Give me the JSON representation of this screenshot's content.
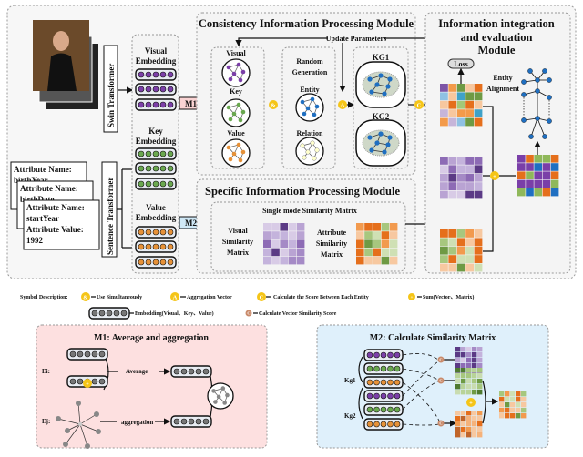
{
  "modules": {
    "consistency_title": "Consistency Information Processing Module",
    "specific_title": "Specific Information Processing Module",
    "integration_title": [
      "Information integration",
      "and evaluation",
      "Module"
    ],
    "update_parameters": "Update Parameters",
    "loss": "Loss",
    "entity_alignment": [
      "Entity",
      "Alignment"
    ]
  },
  "encoders": {
    "swin": "Swin Transformer",
    "sentence": "Sentence Transformer"
  },
  "embeddings": {
    "visual": [
      "Visual",
      "Embedding"
    ],
    "key": [
      "Key",
      "Embedding"
    ],
    "value": [
      "Value",
      "Embedding"
    ]
  },
  "attribute_cards": [
    {
      "lines": [
        "Attribute Name:",
        "birthYear"
      ]
    },
    {
      "lines": [
        "Attribute Name:",
        "birthDate"
      ]
    },
    {
      "lines": [
        "Attribute Name:",
        "startYear",
        "Attribute Value:",
        "1992"
      ]
    }
  ],
  "m1_tag": "M1",
  "m2_tag": "M2",
  "consistency": {
    "visual": "Visual",
    "key": "Key",
    "value": "Value",
    "random_generation": [
      "Random",
      "Generation"
    ],
    "entity": "Entity",
    "relation": "Relation",
    "kg1": "KG1",
    "kg2": "KG2"
  },
  "specific": {
    "single_mode": "Single mode Similarity Matrix",
    "visual_matrix": [
      "Visual",
      "Similarity",
      "Matrix"
    ],
    "attribute_matrix": [
      "Attribute",
      "Similarity",
      "Matrix"
    ]
  },
  "symbols": {
    "and": "&",
    "aggregate": "A",
    "score": "C",
    "sum": "+",
    "vector_score": "C"
  },
  "legend": {
    "title": "Symbol Description:",
    "use_simultaneously": "Use Simultaneously",
    "aggregation_vector": "Aggregation Vector",
    "calc_score": "Calculate the Score Between Each Entity",
    "sum": "Sum(Vector、Matrix)",
    "embedding": "Embedding(Visual、Key、Value)",
    "vector_similarity": "Calculate Vector Similarity Score"
  },
  "m1_panel": {
    "title": "M1: Average and aggregation",
    "ei": "Ei:",
    "ej": "Ej:",
    "average": "Average",
    "aggregation": "aggregation"
  },
  "m2_panel": {
    "title": "M2: Calculate Similarity Matrix",
    "kg1": "Kg1",
    "kg2": "Kg2"
  },
  "colors": {
    "visual": "#7b3fa8",
    "key": "#6aa84f",
    "value": "#e69138",
    "entity": "#1f6fc1",
    "symbol": "#f5c518",
    "m1_bg": "#fde0e0",
    "m2_bg": "#dff0fb",
    "m1_tag_bg": "#f9d3d3",
    "m2_tag_bg": "#cfe8f6"
  }
}
